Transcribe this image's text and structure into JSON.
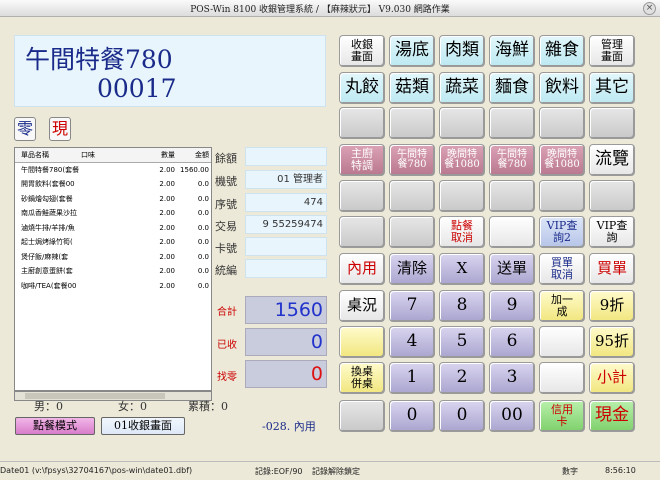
{
  "window": {
    "title": "POS-Win 8100 收銀管理系統 / 【麻辣狀元】 V9.030 網路作業",
    "close_glyph": "×"
  },
  "display": {
    "line1": "午間特餐780",
    "line2": "00017"
  },
  "quick": {
    "zero": "零",
    "cash": "現"
  },
  "table": {
    "headers": {
      "name": "單品名稱",
      "flavor": "口味",
      "qty": "數量",
      "amount": "金額"
    },
    "rows": [
      {
        "name": "午間特餐780(套餐",
        "qty": "2.00",
        "amount": "1560.00"
      },
      {
        "name": "開胃飲料(套餐00",
        "qty": "2.00",
        "amount": "0.0"
      },
      {
        "name": "砂鍋燴勾翅(套餐",
        "qty": "2.00",
        "amount": "0.0"
      },
      {
        "name": "南瓜香鮭蔬果沙拉",
        "qty": "2.00",
        "amount": "0.0"
      },
      {
        "name": "滷燒牛排/羊排/魚",
        "qty": "2.00",
        "amount": "0.0"
      },
      {
        "name": "起士焗烤綠竹筍(",
        "qty": "2.00",
        "amount": "0.0"
      },
      {
        "name": "煲仔飯/麻辣(套",
        "qty": "2.00",
        "amount": "0.0"
      },
      {
        "name": "主廚創意蛋餅(套",
        "qty": "2.00",
        "amount": "0.0"
      },
      {
        "name": "咖啡/TEA(套餐00",
        "qty": "2.00",
        "amount": "0.0"
      }
    ]
  },
  "fields": [
    {
      "label": "餘額",
      "value": ""
    },
    {
      "label": "機號",
      "value": "01 管理者"
    },
    {
      "label": "序號",
      "value": "474"
    },
    {
      "label": "交易",
      "value": "9 55259474"
    },
    {
      "label": "卡號",
      "value": ""
    },
    {
      "label": "統編",
      "value": ""
    }
  ],
  "totals": {
    "total_label": "合計",
    "total_value": "1560",
    "paid_label": "已收",
    "paid_value": "0",
    "change_label": "找零",
    "change_value": "0"
  },
  "counts": {
    "male": "男：0",
    "female": "女：0",
    "accum": "累積：0"
  },
  "modes": {
    "order_mode": "點餐模式",
    "cashier_screen": "01收銀畫面"
  },
  "in_use": "-028. 內用",
  "keys": {
    "r1": [
      "收銀\n畫面",
      "湯底",
      "肉類",
      "海鮮",
      "雜食",
      "管理\n畫面"
    ],
    "r2": [
      "丸餃",
      "菇類",
      "蔬菜",
      "麵食",
      "飲料",
      "其它"
    ],
    "r4": [
      "主廚\n特調",
      "午間特\n餐780",
      "晚間特\n餐1080",
      "午間特\n餐780",
      "晚間特\n餐1080",
      "流覽"
    ],
    "r6": [
      "點餐\n取消",
      "VIP查\n詢2",
      "VIP查\n詢"
    ],
    "r7": [
      "內用",
      "清除",
      "X",
      "送單",
      "買單\n取消",
      "買單"
    ],
    "r8": [
      "桌況",
      "7",
      "8",
      "9",
      "加一\n成",
      "9折"
    ],
    "r9": [
      "4",
      "5",
      "6",
      "95折"
    ],
    "r10": [
      "換桌\n併桌",
      "1",
      "2",
      "3",
      "小計"
    ],
    "r11": [
      "0",
      "0",
      "00",
      "信用\n卡",
      "現金"
    ]
  },
  "status": {
    "file": "Date01 (v:\\fpsys\\32704167\\pos-win\\date01.dbf)",
    "record": "記錄:EOF/90",
    "lock": "記錄解除鎖定",
    "mode": "數字",
    "time": "8:56:10"
  },
  "colors": {
    "display_text": "#1a2a8a",
    "total_value": "#2233cc",
    "change_value": "#dd1111",
    "red_label": "#cc0000"
  }
}
